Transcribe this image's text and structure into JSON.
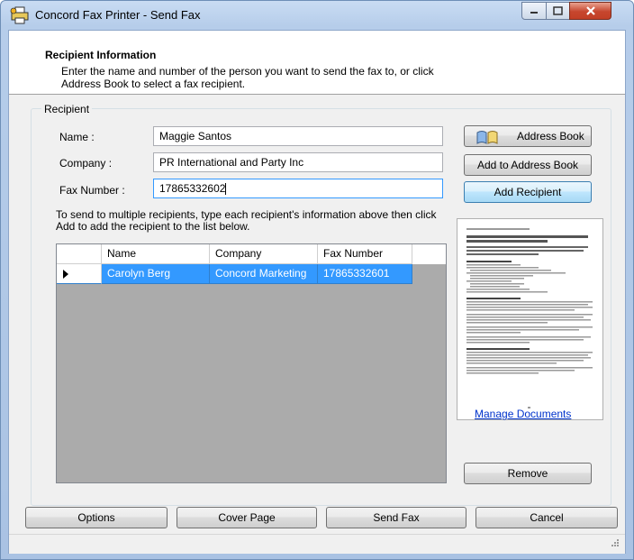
{
  "window": {
    "title": "Concord Fax Printer - Send Fax"
  },
  "header": {
    "title": "Recipient Information",
    "description": "Enter the name and number of the person you want to send the fax to, or click Address Book to select a fax recipient."
  },
  "recipient": {
    "group_label": "Recipient",
    "name_label": "Name :",
    "name_value": "Maggie Santos",
    "company_label": "Company :",
    "company_value": "PR International and Party Inc",
    "fax_label": "Fax Number :",
    "fax_value": "17865332602",
    "address_book_button": "Address Book",
    "add_to_address_book_button": "Add to Address Book",
    "add_recipient_button": "Add Recipient",
    "instructions": "To send to multiple recipients, type each recipient's information above then click Add to add the recipient to the list below."
  },
  "grid": {
    "columns": [
      "Name",
      "Company",
      "Fax Number"
    ],
    "rows": [
      {
        "name": "Carolyn Berg",
        "company": "Concord Marketing",
        "fax": "17865332601"
      }
    ]
  },
  "documents": {
    "manage_link": "Manage Documents",
    "remove_button": "Remove"
  },
  "footer": {
    "options": "Options",
    "cover_page": "Cover Page",
    "send_fax": "Send Fax",
    "cancel": "Cancel"
  },
  "colors": {
    "selection": "#3399ff",
    "link": "#0033cc",
    "grid_empty": "#ababab"
  }
}
